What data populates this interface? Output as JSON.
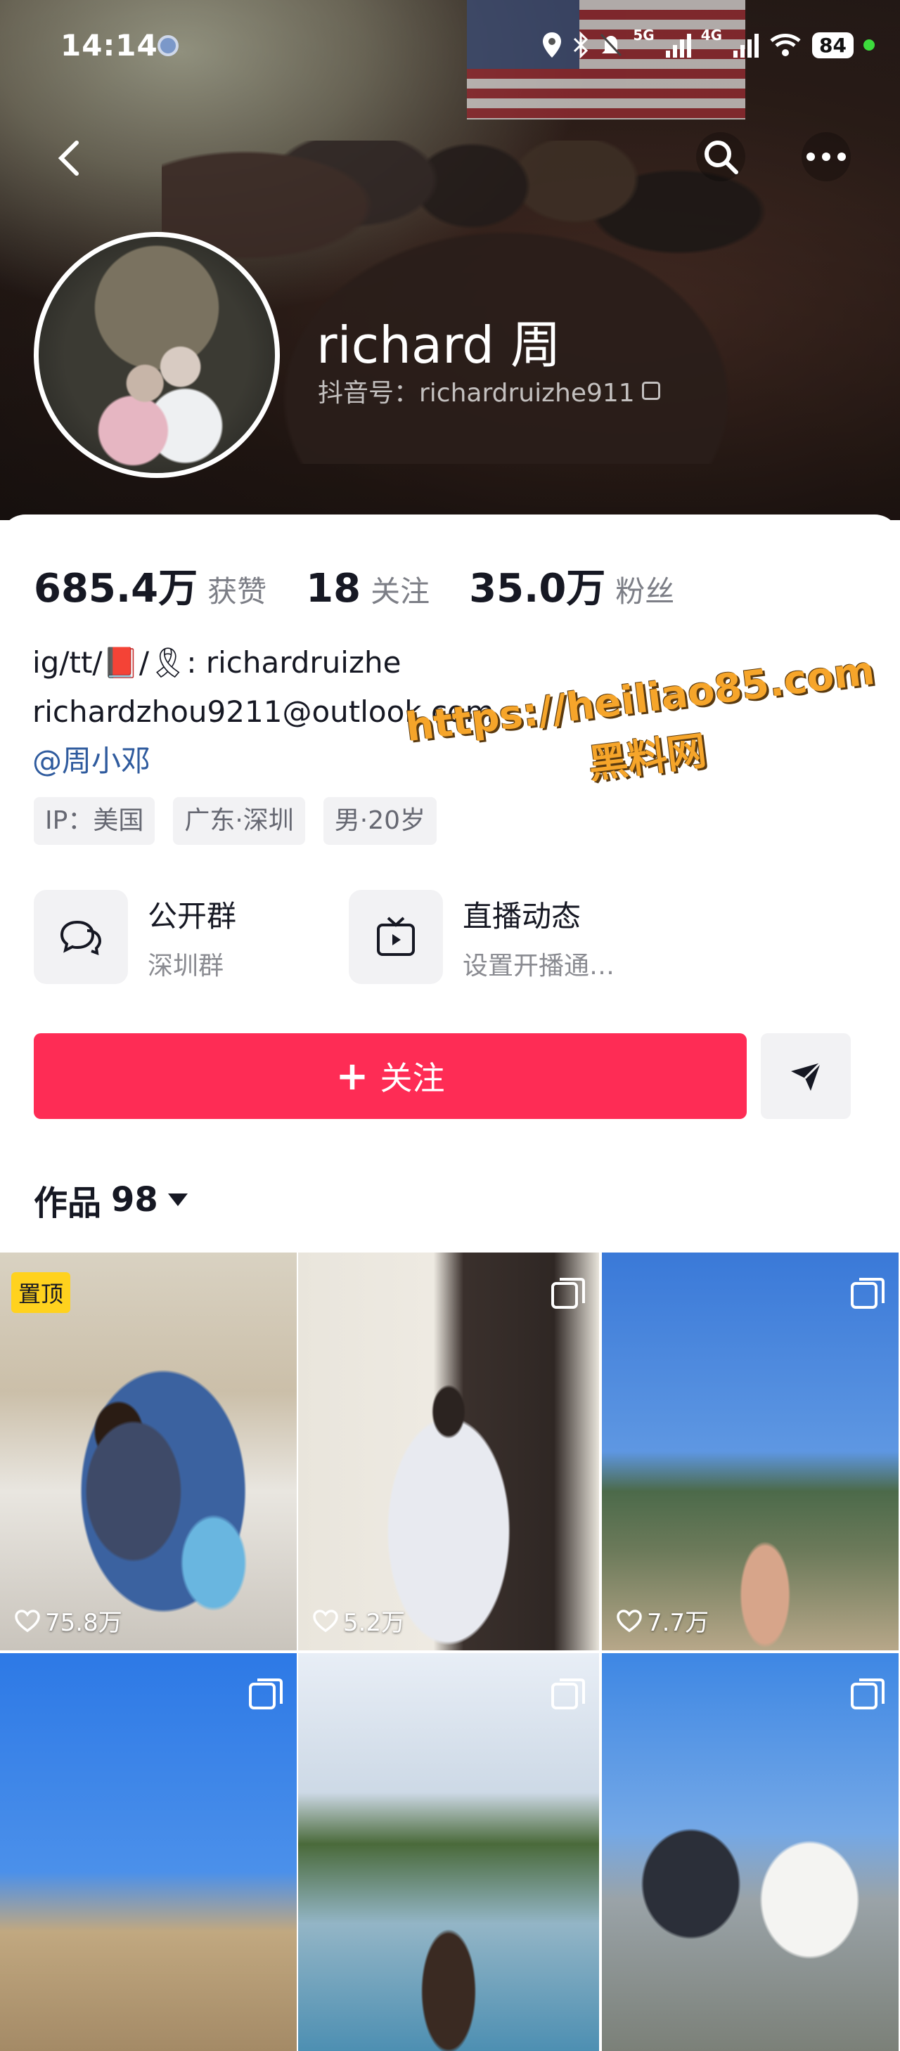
{
  "status_bar": {
    "time": "14:14",
    "signal_1_label": "5G",
    "signal_2_label": "4G",
    "battery": "84"
  },
  "header": {
    "back_icon": "chevron-left-icon",
    "search_icon": "search-icon",
    "more_icon": "more-horizontal-icon"
  },
  "profile": {
    "name": "richard 周",
    "douyin_id": "抖音号：richardruizhe911"
  },
  "stats": [
    {
      "value": "685.4万",
      "label": "获赞"
    },
    {
      "value": "18",
      "label": "关注"
    },
    {
      "value": "35.0万",
      "label": "粉丝"
    }
  ],
  "bio": {
    "line1": "ig/tt/📕/🎗: richardruizhe",
    "line2": "richardzhou9211@outlook.com",
    "mention": "@周小邓"
  },
  "tags": [
    "IP：美国",
    "广东·深圳",
    "男·20岁"
  ],
  "entries": [
    {
      "title": "公开群",
      "subtitle": "深圳群",
      "icon": "chat-group-icon"
    },
    {
      "title": "直播动态",
      "subtitle": "设置开播通…",
      "icon": "live-tv-icon"
    }
  ],
  "actions": {
    "follow_label": "关注",
    "share_icon": "send-icon"
  },
  "works_tab": {
    "label": "作品",
    "count": "98"
  },
  "watermark": {
    "url": "https://heiliao85.com",
    "name": "黑料网"
  },
  "grid": [
    {
      "pinned": "置顶",
      "likes": "75.8万"
    },
    {
      "likes": "5.2万"
    },
    {
      "likes": "7.7万"
    },
    {},
    {},
    {}
  ],
  "colors": {
    "follow": "#fe2c55",
    "mention": "#2f5b9e",
    "pin": "#ffd21e"
  }
}
